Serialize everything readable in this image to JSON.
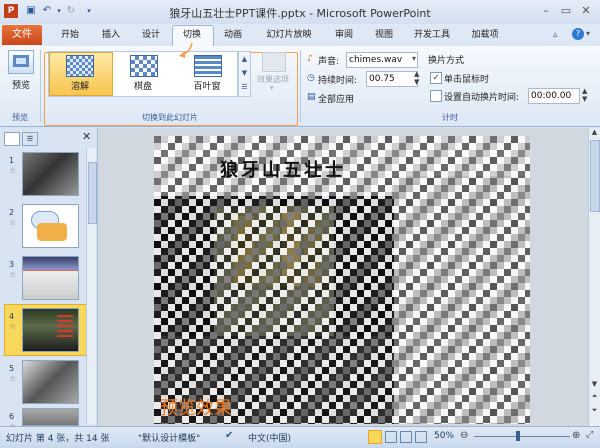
{
  "window": {
    "title": "狼牙山五壮士PPT课件.pptx - Microsoft PowerPoint"
  },
  "tabs": [
    "开始",
    "插入",
    "设计",
    "切换",
    "动画",
    "幻灯片放映",
    "审阅",
    "视图",
    "开发工具",
    "加载项"
  ],
  "file_tab": "文件",
  "ribbon": {
    "preview": {
      "label": "预览",
      "group": "预览"
    },
    "transitions": {
      "group": "切换到此幻灯片",
      "items": [
        "溶解",
        "棋盘",
        "百叶窗"
      ],
      "effect_options": "效果选项"
    },
    "timing": {
      "group": "计时",
      "sound_label": "声音:",
      "sound_value": "chimes.wav",
      "duration_label": "持续时间:",
      "duration_value": "00.75",
      "apply_all": "全部应用",
      "advance_heading": "换片方式",
      "on_click": "单击鼠标时",
      "auto_advance": "设置自动换片时间:",
      "auto_time": "00:00.00"
    }
  },
  "slides": {
    "numbers": [
      "1",
      "2",
      "3",
      "4",
      "5",
      "6"
    ],
    "selected": "4"
  },
  "slide": {
    "title": "狼牙山五壮士",
    "caption": "预览效果"
  },
  "status": {
    "slide_info": "幻灯片 第 4 张，共 14 张",
    "theme": "\"默认设计模板\"",
    "language": "中文(中国)",
    "zoom": "50%"
  },
  "colors": {
    "file_tab": "#d35a26",
    "accent": "#f0a050",
    "selection": "#f8d85a"
  }
}
